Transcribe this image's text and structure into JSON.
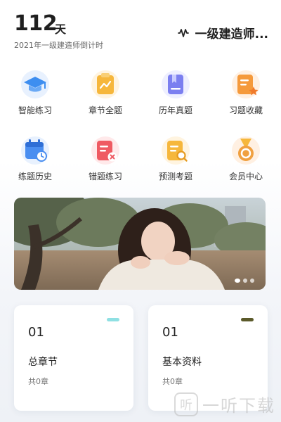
{
  "header": {
    "countdown_days": "112",
    "countdown_unit": "天",
    "countdown_caption": "2021年一级建造师倒计时",
    "exam_name": "一级建造师..."
  },
  "features": [
    {
      "label": "智能练习",
      "icon": "graduation-cap-icon",
      "color": "#3d8ef0"
    },
    {
      "label": "章节全题",
      "icon": "chart-clipboard-icon",
      "color": "#f6b73c"
    },
    {
      "label": "历年真题",
      "icon": "bookmark-book-icon",
      "color": "#7b7ff0"
    },
    {
      "label": "习题收藏",
      "icon": "star-document-icon",
      "color": "#f59a3c"
    },
    {
      "label": "练题历史",
      "icon": "calendar-clock-icon",
      "color": "#4a8ef0"
    },
    {
      "label": "错题练习",
      "icon": "wrong-document-icon",
      "color": "#ef5a62"
    },
    {
      "label": "预测考题",
      "icon": "search-document-icon",
      "color": "#f6b73c"
    },
    {
      "label": "会员中心",
      "icon": "medal-icon",
      "color": "#f0a040"
    }
  ],
  "banner": {
    "slide_count": 3
  },
  "cards": [
    {
      "number": "01",
      "title": "总章节",
      "subtitle": "共0章",
      "accent": "#8fe0e3"
    },
    {
      "number": "01",
      "title": "基本资料",
      "subtitle": "共0章",
      "accent": "#5b5a2a"
    }
  ],
  "watermark": {
    "text": "一听下载"
  }
}
